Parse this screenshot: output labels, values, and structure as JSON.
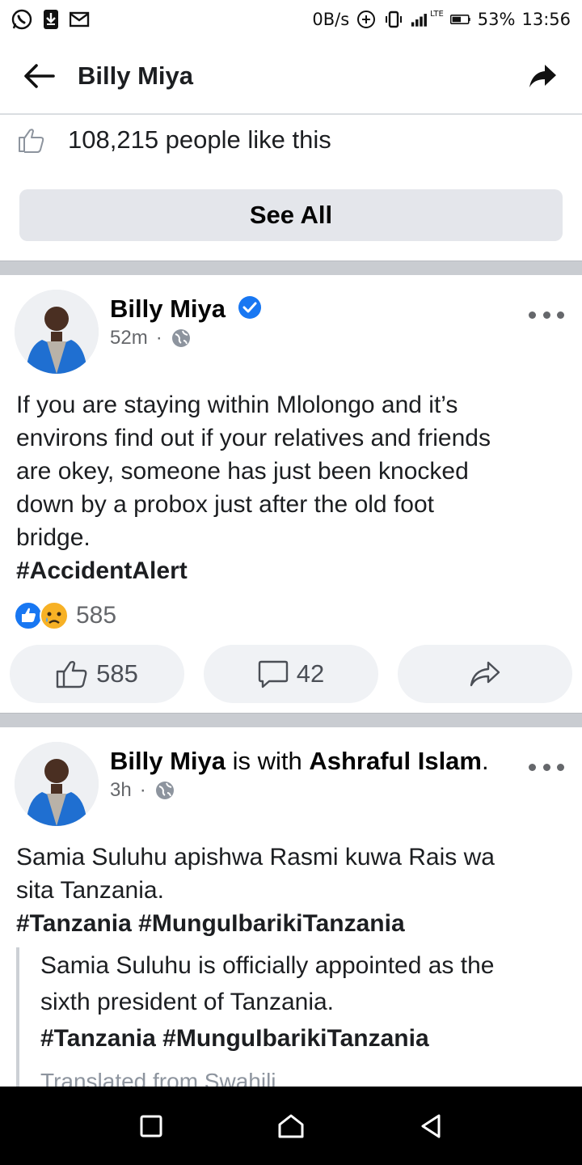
{
  "status_bar": {
    "speed": "0B/s",
    "network": "LTE",
    "battery": "53%",
    "time": "13:56"
  },
  "app_bar": {
    "title": "Billy Miya"
  },
  "page_likes": {
    "text": "108,215 people like this",
    "see_all_label": "See All"
  },
  "posts": [
    {
      "author": "Billy Miya",
      "verified": true,
      "time": "52m",
      "body_lines": [
        "If you are staying within Mlolongo and it’s",
        "environs find out if your relatives and friends",
        "are okey, someone has just been knocked",
        "down by a probox just after the old foot",
        "bridge."
      ],
      "hashtags": "#AccidentAlert",
      "reaction_count": "585",
      "like_count": "585",
      "comment_count": "42"
    },
    {
      "author": "Billy Miya",
      "with_text": " is with ",
      "tagged": "Ashraful Islam",
      "tagged_suffix": ".",
      "time": "3h",
      "body_lines": [
        "Samia Suluhu apishwa Rasmi kuwa Rais wa",
        "sita Tanzania."
      ],
      "hashtags": "#Tanzania #MunguIbarikiTanzania",
      "translation_lines": [
        "Samia Suluhu is officially appointed as the",
        "sixth president of Tanzania."
      ],
      "translation_hashtags": "#Tanzania #MunguIbarikiTanzania",
      "translated_from": "Translated from Swahili"
    }
  ],
  "colors": {
    "facebook_blue": "#1877f2",
    "text_primary": "#1c1e21",
    "text_secondary": "#65676b",
    "button_bg": "#e4e6eb",
    "divider": "#c9ccd1"
  },
  "icons": {
    "whatsapp": "whatsapp-icon",
    "download": "download-icon",
    "mail": "mail-icon",
    "back": "arrow-left-icon",
    "share": "share-arrow-icon",
    "like": "thumbs-up-icon",
    "comment": "comment-bubble-icon",
    "globe": "globe-icon"
  }
}
